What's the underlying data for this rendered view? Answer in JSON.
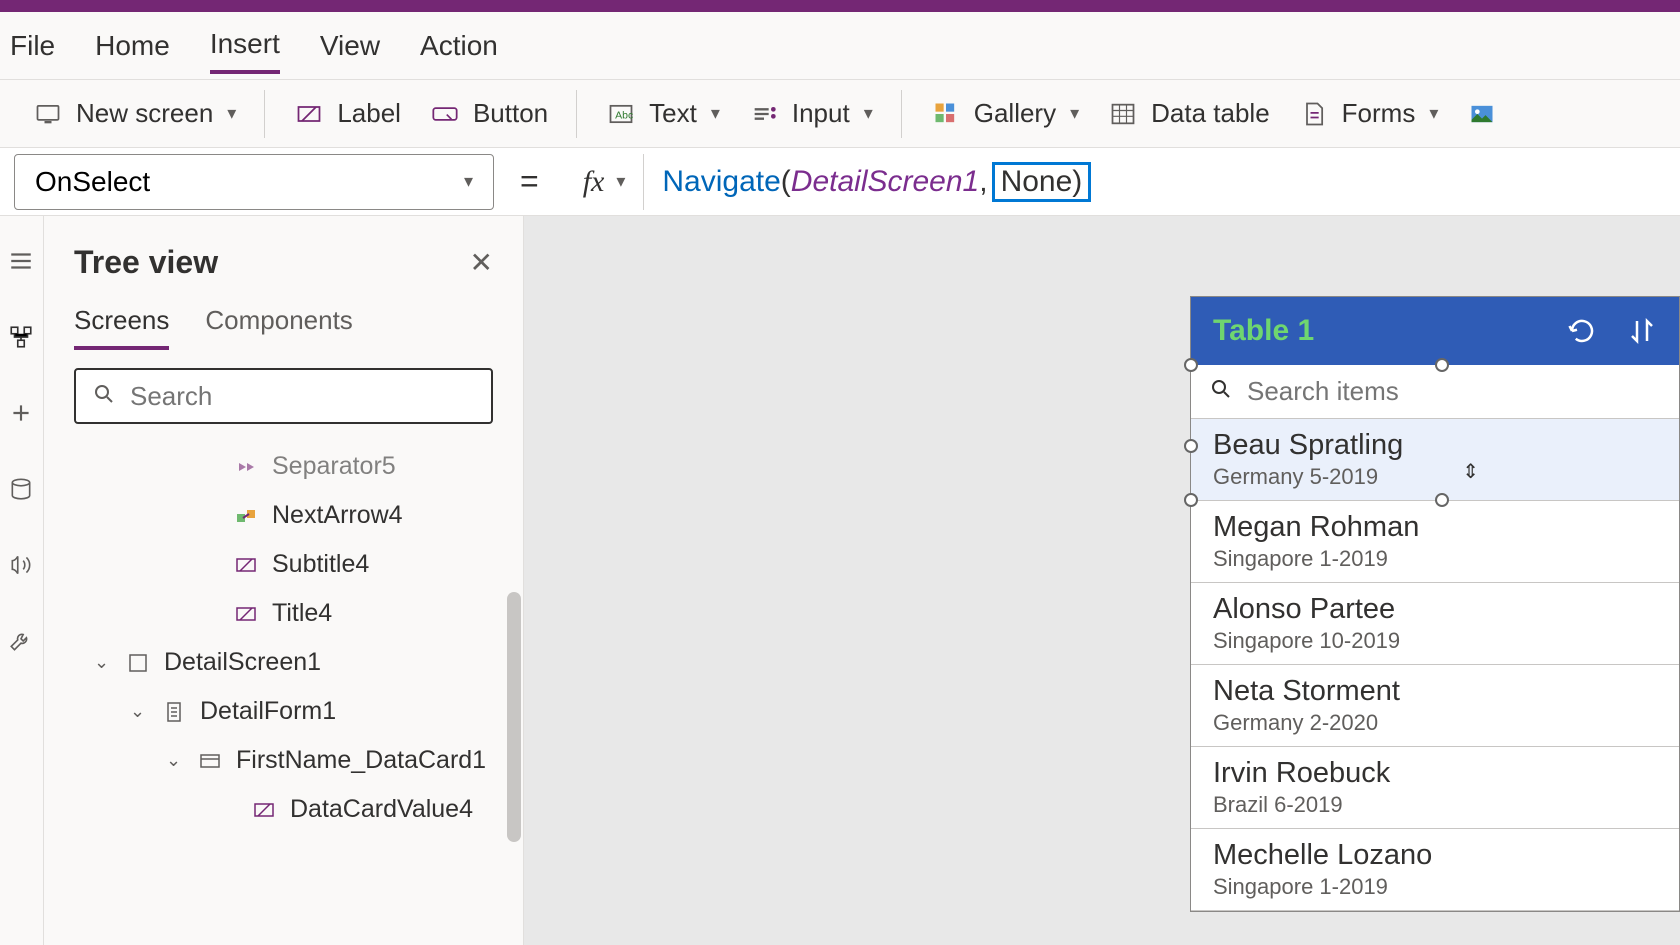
{
  "menu": {
    "items": [
      "File",
      "Home",
      "Insert",
      "View",
      "Action"
    ],
    "active": "Insert"
  },
  "ribbon": {
    "newScreen": "New screen",
    "label": "Label",
    "button": "Button",
    "text": "Text",
    "input": "Input",
    "gallery": "Gallery",
    "dataTable": "Data table",
    "forms": "Forms"
  },
  "formula": {
    "property": "OnSelect",
    "fx": "fx",
    "fn": "Navigate",
    "arg1": "DetailScreen1",
    "arg2": "None)",
    "comma": ", "
  },
  "tree": {
    "title": "Tree view",
    "tabs": {
      "screens": "Screens",
      "components": "Components"
    },
    "searchPlaceholder": "Search",
    "nodes": [
      {
        "label": "Separator5",
        "indent": 3,
        "icon": "sep",
        "cut": true
      },
      {
        "label": "NextArrow4",
        "indent": 3,
        "icon": "arrow"
      },
      {
        "label": "Subtitle4",
        "indent": 3,
        "icon": "text"
      },
      {
        "label": "Title4",
        "indent": 3,
        "icon": "text"
      },
      {
        "label": "DetailScreen1",
        "indent": 0,
        "icon": "screen",
        "exp": true
      },
      {
        "label": "DetailForm1",
        "indent": 1,
        "icon": "form",
        "exp": true
      },
      {
        "label": "FirstName_DataCard1",
        "indent": 2,
        "icon": "card",
        "exp": true
      },
      {
        "label": "DataCardValue4",
        "indent": 4,
        "icon": "text"
      }
    ]
  },
  "phone": {
    "title": "Table 1",
    "searchPlaceholder": "Search items",
    "rows": [
      {
        "title": "Beau Spratling",
        "sub": "Germany 5-2019",
        "selected": true
      },
      {
        "title": "Megan Rohman",
        "sub": "Singapore 1-2019"
      },
      {
        "title": "Alonso Partee",
        "sub": "Singapore 10-2019"
      },
      {
        "title": "Neta Storment",
        "sub": "Germany 2-2020"
      },
      {
        "title": "Irvin Roebuck",
        "sub": "Brazil 6-2019"
      },
      {
        "title": "Mechelle Lozano",
        "sub": "Singapore 1-2019"
      }
    ]
  }
}
